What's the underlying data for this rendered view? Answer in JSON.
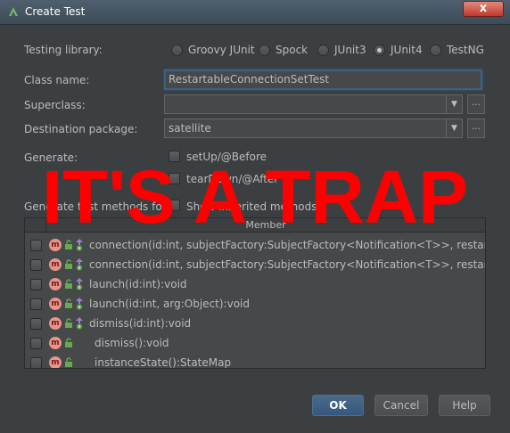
{
  "window": {
    "title": "Create Test",
    "close_label": "x",
    "app_icon": "android-studio-icon"
  },
  "form": {
    "testing_library_label": "Testing library:",
    "radios": [
      {
        "label": "Groovy JUnit",
        "selected": false
      },
      {
        "label": "Spock",
        "selected": false
      },
      {
        "label": "JUnit3",
        "selected": false
      },
      {
        "label": "JUnit4",
        "selected": true
      },
      {
        "label": "TestNG",
        "selected": false
      }
    ],
    "class_name_label": "Class name:",
    "class_name_value": "RestartableConnectionSetTest",
    "superclass_label": "Superclass:",
    "superclass_value": "",
    "destination_label": "Destination package:",
    "destination_value": "satellite",
    "ellipsis": "...",
    "generate_label": "Generate:",
    "setup_label": "setUp/@Before",
    "teardown_label": "tearDown/@After",
    "generate_methods_label": "Generate test methods for:",
    "show_inherited_label": "Show inherited methods"
  },
  "table": {
    "column_header": "Member",
    "rows": [
      {
        "text": "connection(id:int, subjectFactory:SubjectFactory<Notification<T>>, restartableFacto",
        "info": true
      },
      {
        "text": "connection(id:int, subjectFactory:SubjectFactory<Notification<T>>, restartableFacto",
        "info": true
      },
      {
        "text": "launch(id:int):void",
        "info": true
      },
      {
        "text": "launch(id:int, arg:Object):void",
        "info": true
      },
      {
        "text": "dismiss(id:int):void",
        "info": true
      },
      {
        "text": "dismiss():void",
        "info": false
      },
      {
        "text": "instanceState():StateMap",
        "info": false
      }
    ]
  },
  "buttons": {
    "ok": "OK",
    "cancel": "Cancel",
    "help": "Help"
  },
  "overlay": {
    "text": "IT'S A TRAP",
    "color": "#ff0000"
  },
  "colors": {
    "background": "#3c3f41",
    "field": "#45494a",
    "text": "#bbbbbb",
    "focus_border": "#3d6185",
    "method_icon": "#e8938b"
  }
}
